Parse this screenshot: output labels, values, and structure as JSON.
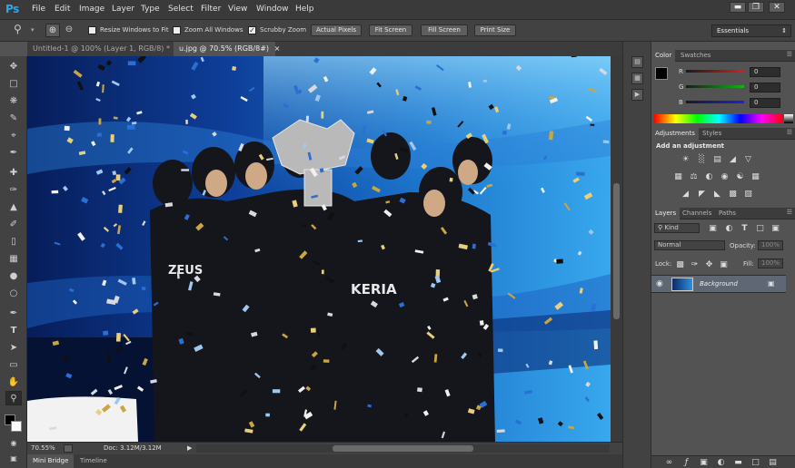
{
  "app": {
    "logo": "Ps",
    "window_controls": [
      "▬",
      "❐",
      "✕"
    ]
  },
  "menu": [
    "File",
    "Edit",
    "Image",
    "Layer",
    "Type",
    "Select",
    "Filter",
    "View",
    "Window",
    "Help"
  ],
  "options": {
    "resize_windows": "Resize Windows to Fit",
    "zoom_all": "Zoom All Windows",
    "scrubby_zoom": "Scrubby Zoom",
    "actual_pixels": "Actual Pixels",
    "fit_screen": "Fit Screen",
    "fill_screen": "Fill Screen",
    "print_size": "Print Size",
    "workspace": "Essentials"
  },
  "tabs": [
    {
      "label": "Untitled-1 @ 100% (Layer 1, RGB/8) *",
      "close": "×"
    },
    {
      "label": "u.jpg @ 70.5% (RGB/8#)",
      "close": "×"
    }
  ],
  "status": {
    "zoom": "70.55%",
    "doc": "Doc: 3.12M/3.12M",
    "arrow": "▶"
  },
  "bottom_tabs": [
    "Mini Bridge",
    "Timeline"
  ],
  "color_panel": {
    "tabs": [
      "Color",
      "Swatches"
    ],
    "channels": [
      {
        "label": "R",
        "value": "0",
        "color": "#d62020"
      },
      {
        "label": "G",
        "value": "0",
        "color": "#18b018"
      },
      {
        "label": "B",
        "value": "0",
        "color": "#2020d6"
      }
    ]
  },
  "adjustments_panel": {
    "tabs": [
      "Adjustments",
      "Styles"
    ],
    "title": "Add an adjustment"
  },
  "layers_panel": {
    "tabs": [
      "Layers",
      "Channels",
      "Paths"
    ],
    "kind": "Kind",
    "blend_mode": "Normal",
    "opacity_label": "Opacity:",
    "opacity": "100%",
    "lock_label": "Lock:",
    "fill_label": "Fill:",
    "fill": "100%",
    "layer_name": "Background"
  },
  "photo_text": {
    "jersey1": "KERIA",
    "jersey2": "ZEUS"
  }
}
